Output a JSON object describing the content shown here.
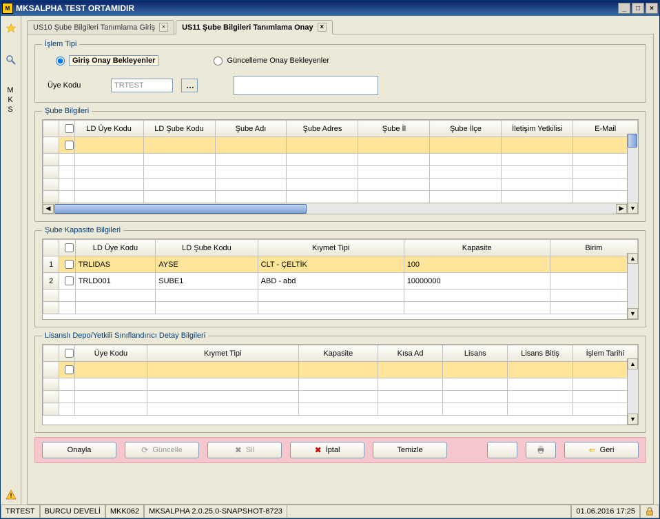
{
  "window": {
    "title": "MKSALPHA TEST ORTAMIDIR"
  },
  "tabs": [
    {
      "label": "US10 Şube Bilgileri Tanımlama Giriş",
      "active": false
    },
    {
      "label": "US11 Şube Bilgileri Tanımlama Onay",
      "active": true
    }
  ],
  "islem_tipi": {
    "legend": "İşlem Tipi",
    "option1": "Giriş Onay Bekleyenler",
    "option2": "Güncelleme Onay Bekleyenler",
    "selected": "option1",
    "uye_kodu_label": "Üye Kodu",
    "uye_kodu_value": "TRTEST"
  },
  "grid1": {
    "legend": "Şube Bilgileri",
    "columns": [
      "LD Üye Kodu",
      "LD Şube Kodu",
      "Şube Adı",
      "Şube Adres",
      "Şube İl",
      "Şube İlçe",
      "İletişim Yetkilisi",
      "E-Mail"
    ]
  },
  "grid2": {
    "legend": "Şube Kapasite Bilgileri",
    "columns": [
      "LD Üye Kodu",
      "LD Şube Kodu",
      "Kıymet Tipi",
      "Kapasite",
      "Birim"
    ],
    "rows": [
      {
        "checked": false,
        "cells": [
          "TRLIDAS",
          "AYSE",
          "CLT - ÇELTİK",
          "100",
          ""
        ]
      },
      {
        "checked": false,
        "cells": [
          "TRLD001",
          "SUBE1",
          "ABD - abd",
          "10000000",
          ""
        ]
      }
    ]
  },
  "grid3": {
    "legend": "Lisanslı Depo/Yetkili Sınıflandırıcı Detay Bilgileri",
    "columns": [
      "Üye Kodu",
      "Kıymet Tipi",
      "Kapasite",
      "Kısa Ad",
      "Lisans",
      "Lisans Bitiş",
      "İşlem Tarihi"
    ]
  },
  "actions": {
    "onayla": "Onayla",
    "guncelle": "Güncelle",
    "sil": "Sil",
    "iptal": "İptal",
    "temizle": "Temizle",
    "geri": "Geri"
  },
  "status": {
    "user_code": "TRTEST",
    "user_name": "BURCU DEVELİ",
    "app_code": "MKK062",
    "version": "MKSALPHA 2.0.25.0-SNAPSHOT-8723",
    "datetime": "01.06.2016 17:25"
  },
  "rail": {
    "label": "MKS"
  }
}
